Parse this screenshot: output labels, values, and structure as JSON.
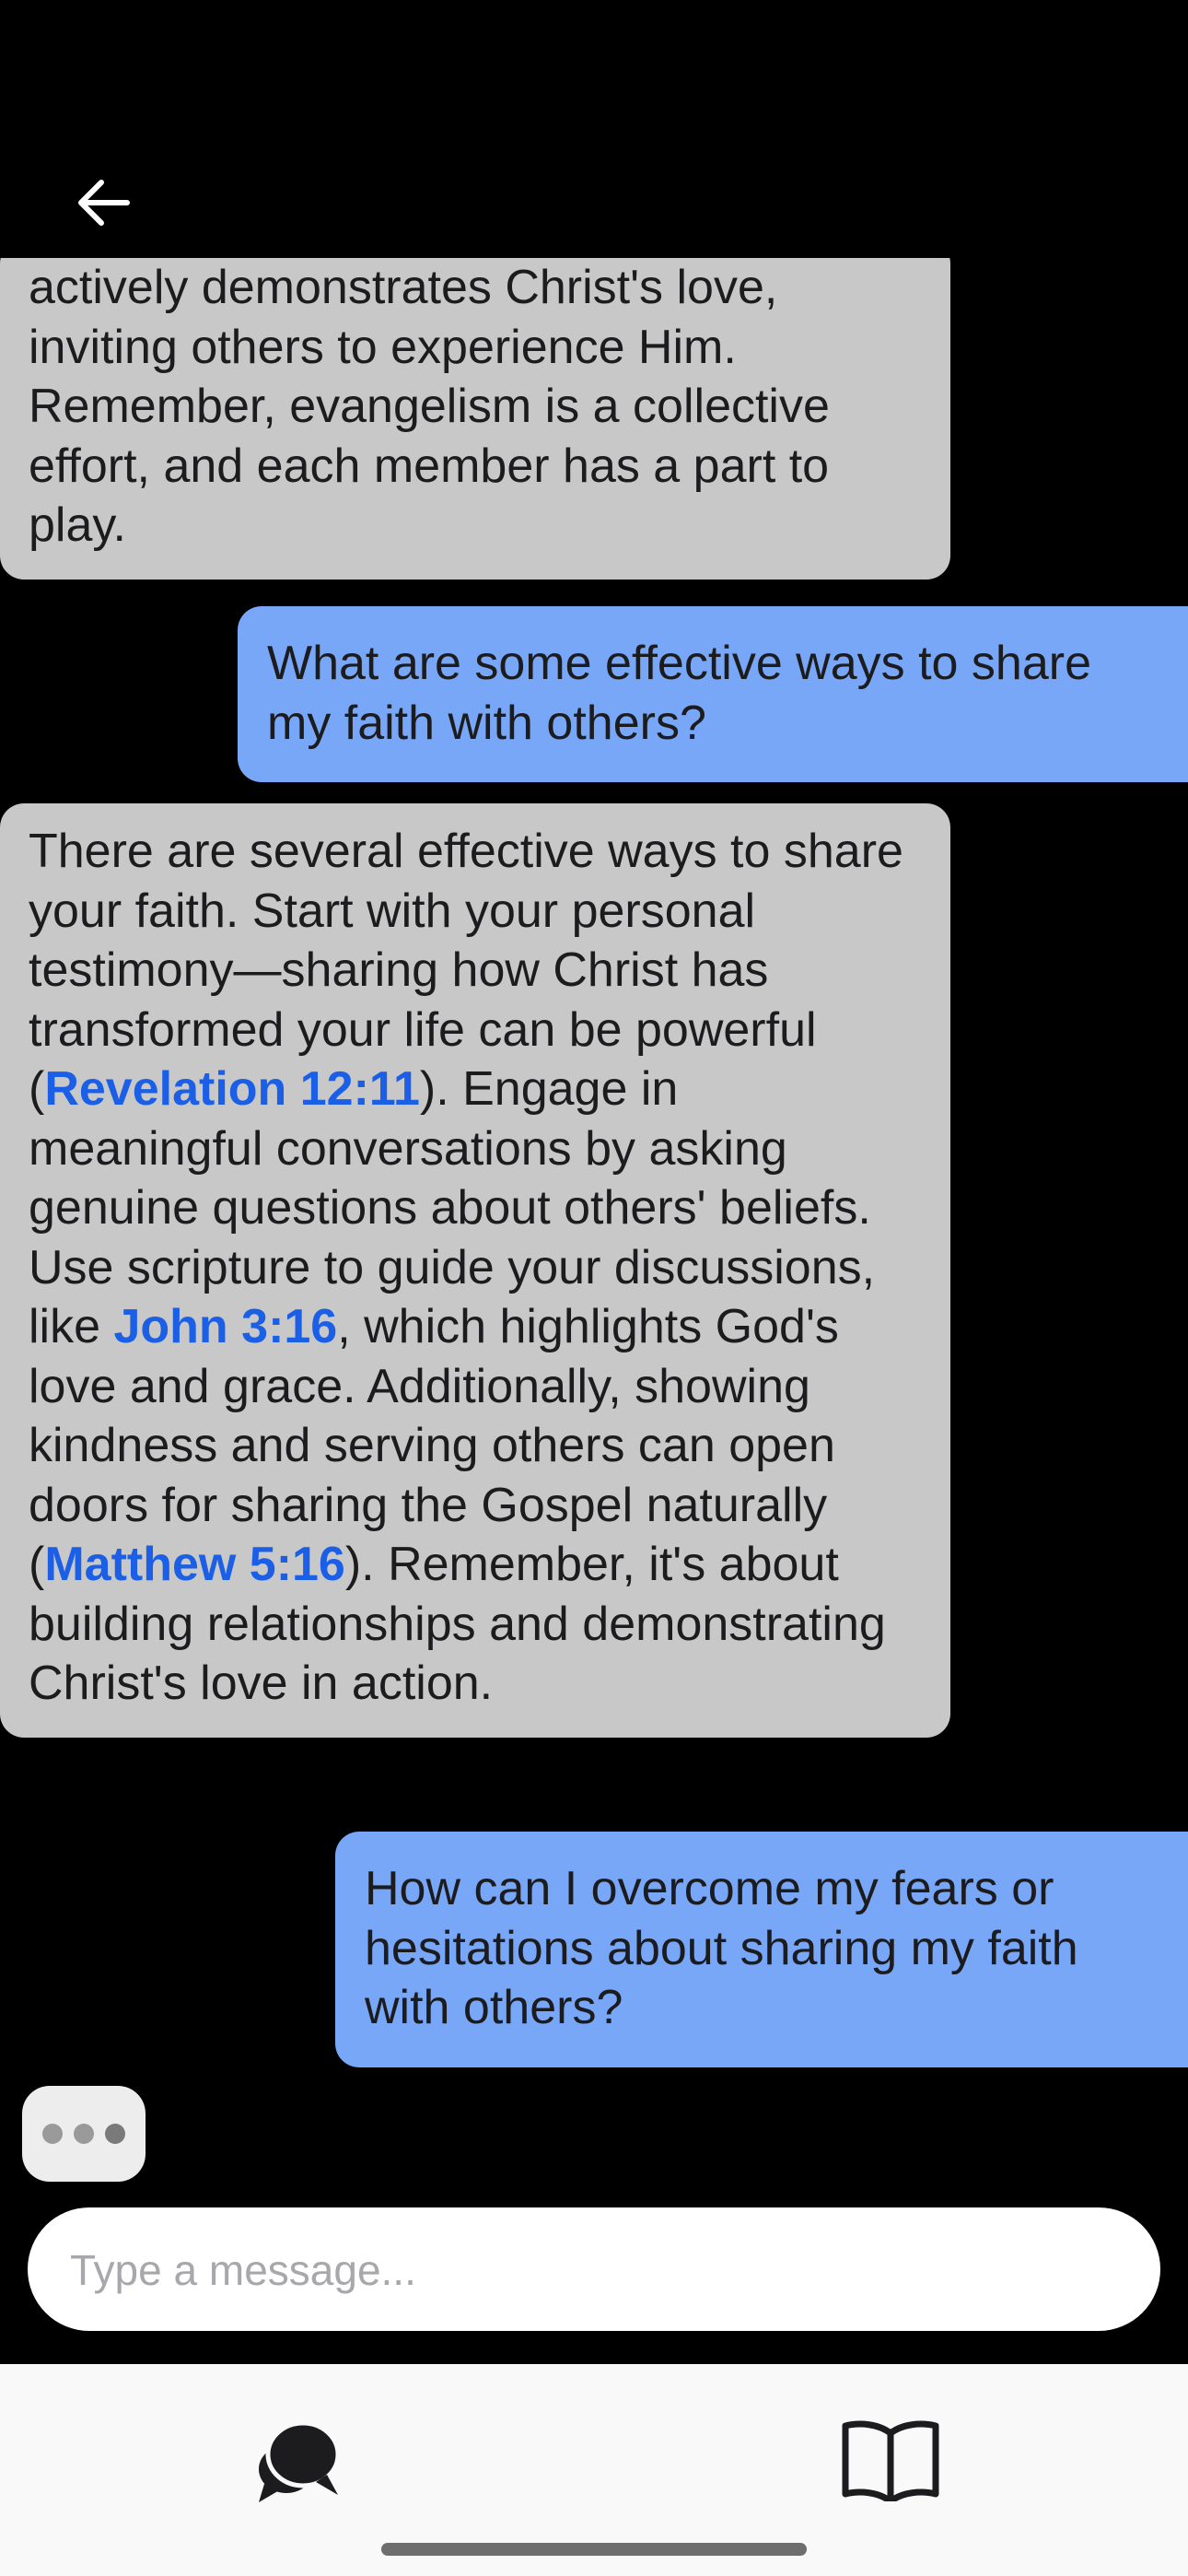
{
  "header": {
    "back_icon": "arrow-left-icon"
  },
  "messages": [
    {
      "role": "bot",
      "text": "actively demonstrates Christ's love, inviting others to experience Him. Remember, evangelism is a collective effort, and each member has a part to play."
    },
    {
      "role": "user",
      "text": "What are some effective ways to share my faith with others?"
    },
    {
      "role": "bot",
      "parts": [
        "There are several effective ways to share your faith. Start with your personal testimony—sharing how Christ has transformed your life can be powerful (",
        "). Engage in meaningful conversations by asking genuine questions about others' beliefs. Use scripture to guide your discussions, like ",
        ", which highlights God's love and grace. Additionally, showing kindness and serving others can open doors for sharing the Gospel naturally (",
        "). Remember, it's about building relationships and demonstrating Christ's love in action."
      ],
      "references": [
        "Revelation 12:11",
        "John 3:16",
        "Matthew 5:16"
      ]
    },
    {
      "role": "user",
      "text": "How can I overcome my fears or hesitations about sharing my faith with others?"
    }
  ],
  "typing_indicator": {
    "icon": "ellipsis-icon"
  },
  "composer": {
    "placeholder": "Type a message...",
    "value": ""
  },
  "tabbar": {
    "tabs": [
      {
        "name": "chat",
        "icon": "chat-bubbles-icon"
      },
      {
        "name": "bible",
        "icon": "open-book-icon"
      }
    ]
  },
  "colors": {
    "background": "#000000",
    "bot_bubble": "#c8c8c8",
    "user_bubble": "#78a7f8",
    "reference_link": "#1a5fe6",
    "tabbar": "#f9f9f9"
  }
}
